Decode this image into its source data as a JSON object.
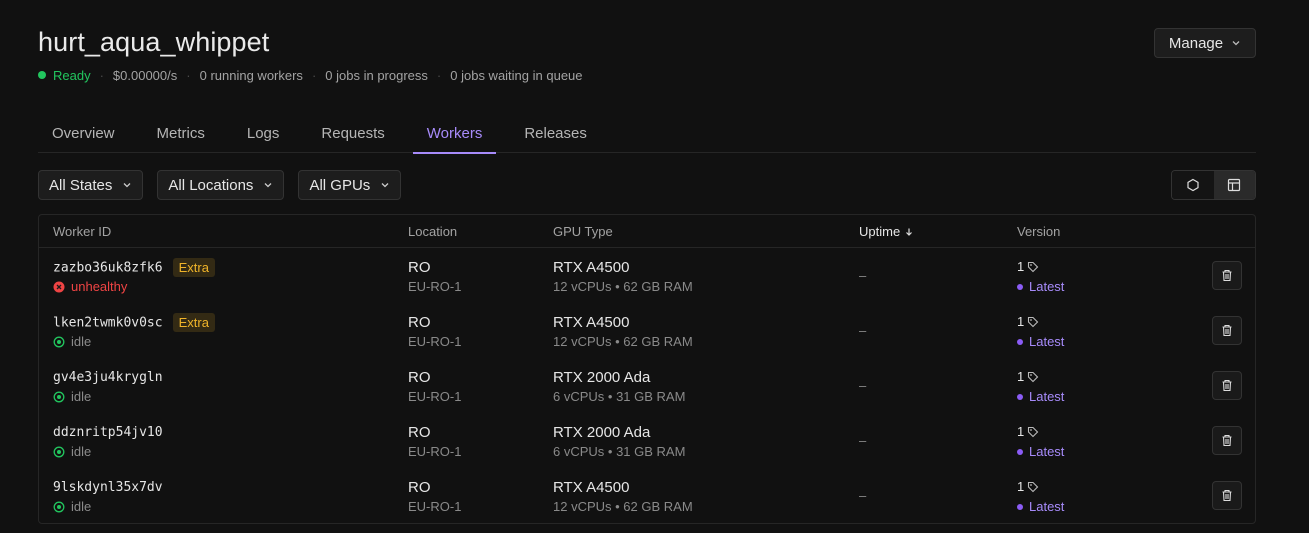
{
  "header": {
    "title": "hurt_aqua_whippet",
    "status": "Ready",
    "cost": "$0.00000/s",
    "running_workers": "0 running workers",
    "jobs_in_progress": "0 jobs in progress",
    "jobs_waiting": "0 jobs waiting in queue",
    "separator": "·",
    "manage_label": "Manage"
  },
  "tabs": [
    {
      "label": "Overview",
      "active": false
    },
    {
      "label": "Metrics",
      "active": false
    },
    {
      "label": "Logs",
      "active": false
    },
    {
      "label": "Requests",
      "active": false
    },
    {
      "label": "Workers",
      "active": true
    },
    {
      "label": "Releases",
      "active": false
    }
  ],
  "filters": {
    "states": "All States",
    "locations": "All Locations",
    "gpus": "All GPUs"
  },
  "table": {
    "headers": {
      "worker_id": "Worker ID",
      "location": "Location",
      "gpu_type": "GPU Type",
      "uptime": "Uptime",
      "version": "Version"
    },
    "rows": [
      {
        "id": "zazbo36uk8zfk6",
        "badge": "Extra",
        "state": "unhealthy",
        "location": "RO",
        "region": "EU-RO-1",
        "gpu": "RTX A4500",
        "specs": "12 vCPUs • 62 GB RAM",
        "uptime": "–",
        "version": "1",
        "tag": "Latest"
      },
      {
        "id": "lken2twmk0v0sc",
        "badge": "Extra",
        "state": "idle",
        "location": "RO",
        "region": "EU-RO-1",
        "gpu": "RTX A4500",
        "specs": "12 vCPUs • 62 GB RAM",
        "uptime": "–",
        "version": "1",
        "tag": "Latest"
      },
      {
        "id": "gv4e3ju4krygln",
        "badge": "",
        "state": "idle",
        "location": "RO",
        "region": "EU-RO-1",
        "gpu": "RTX 2000 Ada",
        "specs": "6 vCPUs • 31 GB RAM",
        "uptime": "–",
        "version": "1",
        "tag": "Latest"
      },
      {
        "id": "ddznritp54jv10",
        "badge": "",
        "state": "idle",
        "location": "RO",
        "region": "EU-RO-1",
        "gpu": "RTX 2000 Ada",
        "specs": "6 vCPUs • 31 GB RAM",
        "uptime": "–",
        "version": "1",
        "tag": "Latest"
      },
      {
        "id": "9lskdynl35x7dv",
        "badge": "",
        "state": "idle",
        "location": "RO",
        "region": "EU-RO-1",
        "gpu": "RTX A4500",
        "specs": "12 vCPUs • 62 GB RAM",
        "uptime": "–",
        "version": "1",
        "tag": "Latest"
      }
    ]
  },
  "colors": {
    "accent": "#a78bfa",
    "ready": "#22c55e",
    "unhealthy": "#ef4444",
    "badge": "#f0b429",
    "background": "#111111"
  },
  "icons": {
    "status": "status-dot-icon",
    "dropdown": "chevron-down-icon",
    "sort": "arrow-down-icon",
    "tag": "tag-icon",
    "delete": "trash-icon",
    "view_grid": "hexagon-icon",
    "view_table": "table-icon",
    "unhealthy": "x-circle-icon",
    "idle": "dot-circle-icon"
  }
}
